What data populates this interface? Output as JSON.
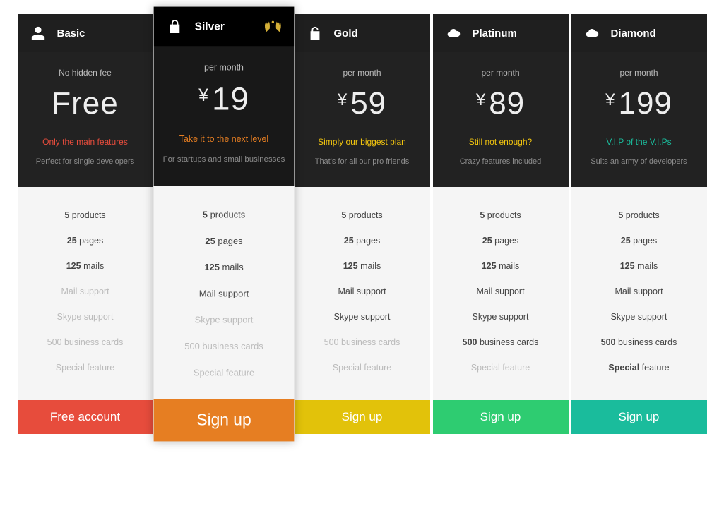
{
  "plans": [
    {
      "id": "basic",
      "name": "Basic",
      "icon": "user",
      "featured": false,
      "period": "No hidden fee",
      "price_text": "Free",
      "currency": "",
      "tagline": "Only the main features",
      "tagline_color": "#e74c3c",
      "subtag": "Perfect for single developers",
      "features": [
        {
          "text_bold": "5",
          "text_rest": " products",
          "disabled": false,
          "bold_first": true
        },
        {
          "text_bold": "25",
          "text_rest": " pages",
          "disabled": false,
          "bold_first": true
        },
        {
          "text_bold": "125",
          "text_rest": " mails",
          "disabled": false,
          "bold_first": true
        },
        {
          "text_bold": "",
          "text_rest": "Mail support",
          "disabled": true,
          "bold_first": false
        },
        {
          "text_bold": "",
          "text_rest": "Skype support",
          "disabled": true,
          "bold_first": false
        },
        {
          "text_bold": "",
          "text_rest": "500 business cards",
          "disabled": true,
          "bold_first": false
        },
        {
          "text_bold": "",
          "text_rest": "Special feature",
          "disabled": true,
          "bold_first": false
        }
      ],
      "cta_label": "Free account",
      "cta_color": "#e74c3c"
    },
    {
      "id": "silver",
      "name": "Silver",
      "icon": "lock",
      "featured": true,
      "laurel": true,
      "period": "per month",
      "price_text": "19",
      "currency": "¥",
      "tagline": "Take it to the next level",
      "tagline_color": "#e67e22",
      "subtag": "For startups and small businesses",
      "features": [
        {
          "text_bold": "5",
          "text_rest": " products",
          "disabled": false,
          "bold_first": true
        },
        {
          "text_bold": "25",
          "text_rest": " pages",
          "disabled": false,
          "bold_first": true
        },
        {
          "text_bold": "125",
          "text_rest": " mails",
          "disabled": false,
          "bold_first": true
        },
        {
          "text_bold": "",
          "text_rest": "Mail support",
          "disabled": false,
          "bold_first": false
        },
        {
          "text_bold": "",
          "text_rest": "Skype support",
          "disabled": true,
          "bold_first": false
        },
        {
          "text_bold": "",
          "text_rest": "500 business cards",
          "disabled": true,
          "bold_first": false
        },
        {
          "text_bold": "",
          "text_rest": "Special feature",
          "disabled": true,
          "bold_first": false
        }
      ],
      "cta_label": "Sign up",
      "cta_color": "#e67e22"
    },
    {
      "id": "gold",
      "name": "Gold",
      "icon": "unlock",
      "featured": false,
      "period": "per month",
      "price_text": "59",
      "currency": "¥",
      "tagline": "Simply our biggest plan",
      "tagline_color": "#f1c40f",
      "subtag": "That's for all our pro friends",
      "features": [
        {
          "text_bold": "5",
          "text_rest": " products",
          "disabled": false,
          "bold_first": true
        },
        {
          "text_bold": "25",
          "text_rest": " pages",
          "disabled": false,
          "bold_first": true
        },
        {
          "text_bold": "125",
          "text_rest": " mails",
          "disabled": false,
          "bold_first": true
        },
        {
          "text_bold": "",
          "text_rest": "Mail support",
          "disabled": false,
          "bold_first": false
        },
        {
          "text_bold": "",
          "text_rest": "Skype support",
          "disabled": false,
          "bold_first": false
        },
        {
          "text_bold": "",
          "text_rest": "500 business cards",
          "disabled": true,
          "bold_first": false
        },
        {
          "text_bold": "",
          "text_rest": "Special feature",
          "disabled": true,
          "bold_first": false
        }
      ],
      "cta_label": "Sign up",
      "cta_color": "#e2c20a"
    },
    {
      "id": "platinum",
      "name": "Platinum",
      "icon": "cloud",
      "featured": false,
      "period": "per month",
      "price_text": "89",
      "currency": "¥",
      "tagline": "Still not enough?",
      "tagline_color": "#f1c40f",
      "subtag": "Crazy features included",
      "features": [
        {
          "text_bold": "5",
          "text_rest": " products",
          "disabled": false,
          "bold_first": true
        },
        {
          "text_bold": "25",
          "text_rest": " pages",
          "disabled": false,
          "bold_first": true
        },
        {
          "text_bold": "125",
          "text_rest": " mails",
          "disabled": false,
          "bold_first": true
        },
        {
          "text_bold": "",
          "text_rest": "Mail support",
          "disabled": false,
          "bold_first": false
        },
        {
          "text_bold": "",
          "text_rest": "Skype support",
          "disabled": false,
          "bold_first": false
        },
        {
          "text_bold": "500",
          "text_rest": " business cards",
          "disabled": false,
          "bold_first": true
        },
        {
          "text_bold": "",
          "text_rest": "Special feature",
          "disabled": true,
          "bold_first": false
        }
      ],
      "cta_label": "Sign up",
      "cta_color": "#2ecc71"
    },
    {
      "id": "diamond",
      "name": "Diamond",
      "icon": "cloud",
      "featured": false,
      "period": "per month",
      "price_text": "199",
      "currency": "¥",
      "tagline": "V.I.P of the V.I.Ps",
      "tagline_color": "#1abc9c",
      "subtag": "Suits an army of developers",
      "features": [
        {
          "text_bold": "5",
          "text_rest": " products",
          "disabled": false,
          "bold_first": true
        },
        {
          "text_bold": "25",
          "text_rest": " pages",
          "disabled": false,
          "bold_first": true
        },
        {
          "text_bold": "125",
          "text_rest": " mails",
          "disabled": false,
          "bold_first": true
        },
        {
          "text_bold": "",
          "text_rest": "Mail support",
          "disabled": false,
          "bold_first": false
        },
        {
          "text_bold": "",
          "text_rest": "Skype support",
          "disabled": false,
          "bold_first": false
        },
        {
          "text_bold": "500",
          "text_rest": " business cards",
          "disabled": false,
          "bold_first": true
        },
        {
          "text_bold": "Special",
          "text_rest": " feature",
          "disabled": false,
          "bold_first": true
        }
      ],
      "cta_label": "Sign up",
      "cta_color": "#1abc9c"
    }
  ]
}
